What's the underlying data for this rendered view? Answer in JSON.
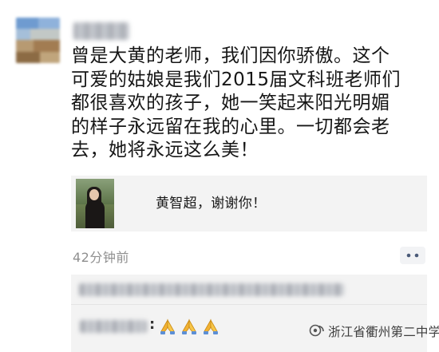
{
  "post": {
    "lines": [
      "曾是大黄的老师，我们因你骄傲。这个",
      "可爱的姑娘是我们2015届文科班老师们",
      "都很喜欢的孩子，她一笑起来阳光明媚",
      "的样子永远留在我的心里。一切都会老",
      "去，她将永远这么美！"
    ]
  },
  "share": {
    "title": "黄智超，谢谢你！"
  },
  "meta": {
    "time": "42分钟前",
    "more_icon": "more-dots-icon"
  },
  "comments": {
    "second_colon": ":",
    "emoji_icon": "prayer-hands-icon",
    "emoji_count": 3
  },
  "watermark": {
    "text": "浙江省衢州第二中学",
    "icon": "wechat-official-account-icon"
  },
  "colors": {
    "text": "#161616",
    "muted": "#8f8f8f",
    "card_bg": "#f3f3f3",
    "link_blue": "#4a5a78"
  }
}
